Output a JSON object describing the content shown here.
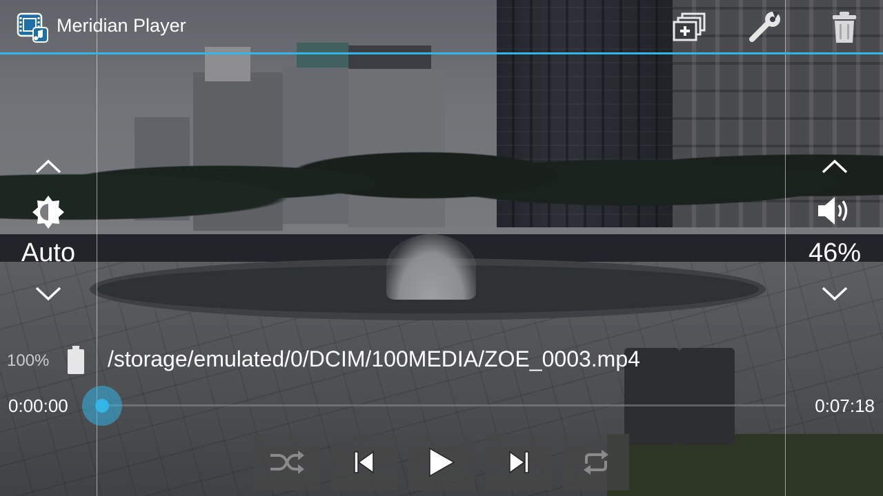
{
  "app": {
    "title": "Meridian Player",
    "icon": "film-music-icon"
  },
  "toolbar": {
    "actions": [
      {
        "name": "add-to-playlist",
        "icon": "add-playlist-icon"
      },
      {
        "name": "settings",
        "icon": "wrench-icon"
      },
      {
        "name": "delete",
        "icon": "trash-icon"
      }
    ]
  },
  "brightness": {
    "value": "Auto",
    "icon": "brightness-icon",
    "up_icon": "chevron-up-icon",
    "down_icon": "chevron-down-icon"
  },
  "volume": {
    "value": "46%",
    "level": 0.46,
    "icon": "speaker-icon",
    "up_icon": "chevron-up-icon",
    "down_icon": "chevron-down-icon"
  },
  "status": {
    "battery": "100%",
    "battery_icon": "battery-icon"
  },
  "media": {
    "file_path": "/storage/emulated/0/DCIM/100MEDIA/ZOE_0003.mp4",
    "current_time": "0:00:00",
    "total_time": "0:07:18",
    "progress": 0.0
  },
  "playback_controls": [
    {
      "name": "shuffle",
      "icon": "shuffle-icon"
    },
    {
      "name": "previous",
      "icon": "skip-previous-icon"
    },
    {
      "name": "play",
      "icon": "play-icon"
    },
    {
      "name": "next",
      "icon": "skip-next-icon"
    },
    {
      "name": "repeat",
      "icon": "repeat-icon"
    }
  ],
  "colors": {
    "accent": "#33b5e5",
    "text": "#ffffff",
    "button_bg": "#464646"
  }
}
